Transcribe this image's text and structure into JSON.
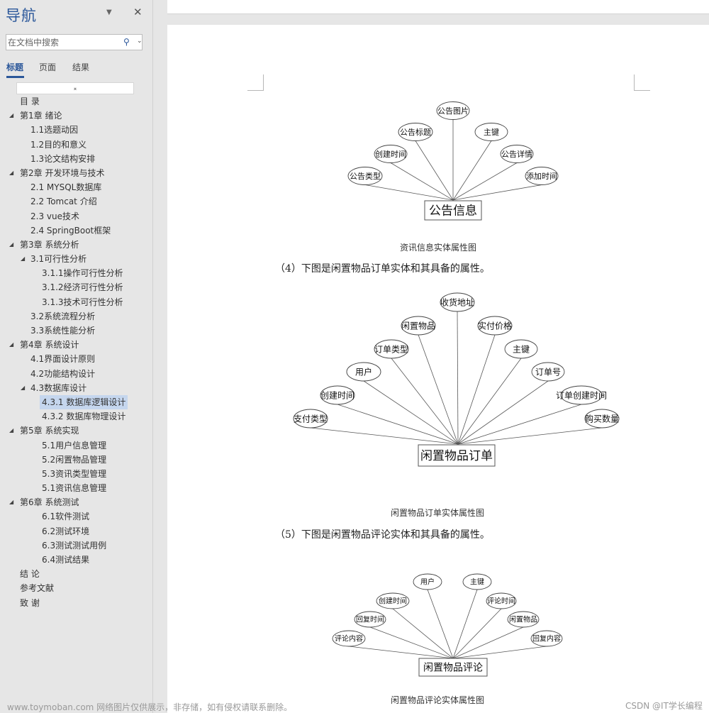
{
  "nav": {
    "title": "导航",
    "menu_icon": "dropdown-triangle-icon",
    "close_icon": "close-icon",
    "search": {
      "placeholder": "在文档中搜索",
      "value": "",
      "icon": "search-icon",
      "dropdown_icon": "chevron-down-icon"
    },
    "tabs": [
      {
        "label": "标题",
        "active": true
      },
      {
        "label": "页面",
        "active": false
      },
      {
        "label": "结果",
        "active": false
      }
    ],
    "scroll_up_glyph": "⌅",
    "tree": [
      {
        "label": "目 录",
        "level": 1,
        "expandable": false
      },
      {
        "label": "第1章 绪论",
        "level": 1,
        "expandable": true
      },
      {
        "label": "1.1选题动因",
        "level": 2,
        "expandable": false
      },
      {
        "label": "1.2目的和意义",
        "level": 2,
        "expandable": false
      },
      {
        "label": "1.3论文结构安排",
        "level": 2,
        "expandable": false
      },
      {
        "label": "第2章 开发环境与技术",
        "level": 1,
        "expandable": true
      },
      {
        "label": "2.1 MYSQL数据库",
        "level": 2,
        "expandable": false
      },
      {
        "label": "2.2 Tomcat 介绍",
        "level": 2,
        "expandable": false
      },
      {
        "label": "2.3 vue技术",
        "level": 2,
        "expandable": false
      },
      {
        "label": "2.4 SpringBoot框架",
        "level": 2,
        "expandable": false
      },
      {
        "label": "第3章 系统分析",
        "level": 1,
        "expandable": true
      },
      {
        "label": "3.1可行性分析",
        "level": 2,
        "expandable": true
      },
      {
        "label": "3.1.1操作可行性分析",
        "level": 3,
        "expandable": false
      },
      {
        "label": "3.1.2经济可行性分析",
        "level": 3,
        "expandable": false
      },
      {
        "label": "3.1.3技术可行性分析",
        "level": 3,
        "expandable": false
      },
      {
        "label": "3.2系统流程分析",
        "level": 2,
        "expandable": false
      },
      {
        "label": "3.3系统性能分析",
        "level": 2,
        "expandable": false
      },
      {
        "label": "第4章 系统设计",
        "level": 1,
        "expandable": true
      },
      {
        "label": "4.1界面设计原则",
        "level": 2,
        "expandable": false
      },
      {
        "label": "4.2功能结构设计",
        "level": 2,
        "expandable": false
      },
      {
        "label": "4.3数据库设计",
        "level": 2,
        "expandable": true
      },
      {
        "label": "4.3.1 数据库逻辑设计",
        "level": 3,
        "expandable": false,
        "selected": true
      },
      {
        "label": "4.3.2 数据库物理设计",
        "level": 3,
        "expandable": false
      },
      {
        "label": "第5章 系统实现",
        "level": 1,
        "expandable": true
      },
      {
        "label": "5.1用户信息管理",
        "level": 3,
        "expandable": false
      },
      {
        "label": "5.2闲置物品管理",
        "level": 3,
        "expandable": false
      },
      {
        "label": "5.3资讯类型管理",
        "level": 3,
        "expandable": false
      },
      {
        "label": "5.1资讯信息管理",
        "level": 3,
        "expandable": false
      },
      {
        "label": "第6章 系统测试",
        "level": 1,
        "expandable": true
      },
      {
        "label": "6.1软件测试",
        "level": 3,
        "expandable": false
      },
      {
        "label": "6.2测试环境",
        "level": 3,
        "expandable": false
      },
      {
        "label": "6.3测试测试用例",
        "level": 3,
        "expandable": false
      },
      {
        "label": "6.4测试结果",
        "level": 3,
        "expandable": false
      },
      {
        "label": "结 论",
        "level": 1,
        "expandable": false
      },
      {
        "label": "参考文献",
        "level": 1,
        "expandable": false
      },
      {
        "label": "致 谢",
        "level": 1,
        "expandable": false
      }
    ]
  },
  "document": {
    "diagrams": [
      {
        "entity": "公告信息",
        "attributes": [
          "公告类型",
          "创建时间",
          "公告标题",
          "公告图片",
          "主键",
          "公告详情",
          "添加时间"
        ],
        "caption": "资讯信息实体属性图"
      },
      {
        "entity": "闲置物品订单",
        "attributes": [
          "支付类型",
          "创建时间",
          "用户",
          "订单类型",
          "闲置物品",
          "收货地址",
          "实付价格",
          "主键",
          "订单号",
          "订单创建时间",
          "购买数量"
        ],
        "caption": "闲置物品订单实体属性图"
      },
      {
        "entity": "闲置物品评论",
        "attributes": [
          "评论内容",
          "回复时间",
          "创建时间",
          "用户",
          "主键",
          "评论时间",
          "闲置物品",
          "回复内容"
        ],
        "caption": "闲置物品评论实体属性图"
      }
    ],
    "paragraphs": [
      "（4）下图是闲置物品订单实体和其具备的属性。",
      "（5）下图是闲置物品评论实体和其具备的属性。"
    ]
  },
  "watermarks": {
    "left": "www.toymoban.com 网络图片仅供展示，非存储，如有侵权请联系删除。",
    "right": "CSDN @IT学长编程"
  }
}
